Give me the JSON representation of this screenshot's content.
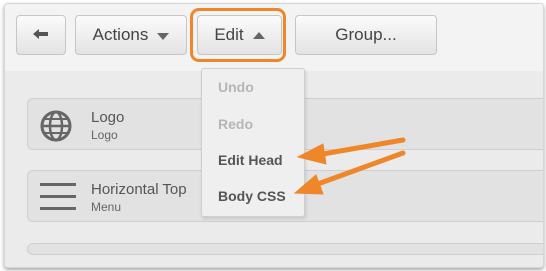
{
  "toolbar": {
    "back_icon": "back-arrow-icon",
    "actions_label": "Actions",
    "edit_label": "Edit",
    "group_label": "Group..."
  },
  "edit_menu": {
    "items": [
      {
        "label": "Undo",
        "enabled": false
      },
      {
        "label": "Redo",
        "enabled": false
      },
      {
        "label": "Edit Head",
        "enabled": true
      },
      {
        "label": "Body CSS",
        "enabled": true
      }
    ]
  },
  "blocks": [
    {
      "title": "Logo",
      "subtitle": "Logo",
      "icon": "globe-icon"
    },
    {
      "title": "Horizontal Top",
      "subtitle": "Menu",
      "icon": "menu-icon"
    }
  ],
  "colors": {
    "highlight": "#f0862a",
    "toolbar_bg": "#f3f3f3",
    "content_bg": "#ebebeb"
  }
}
